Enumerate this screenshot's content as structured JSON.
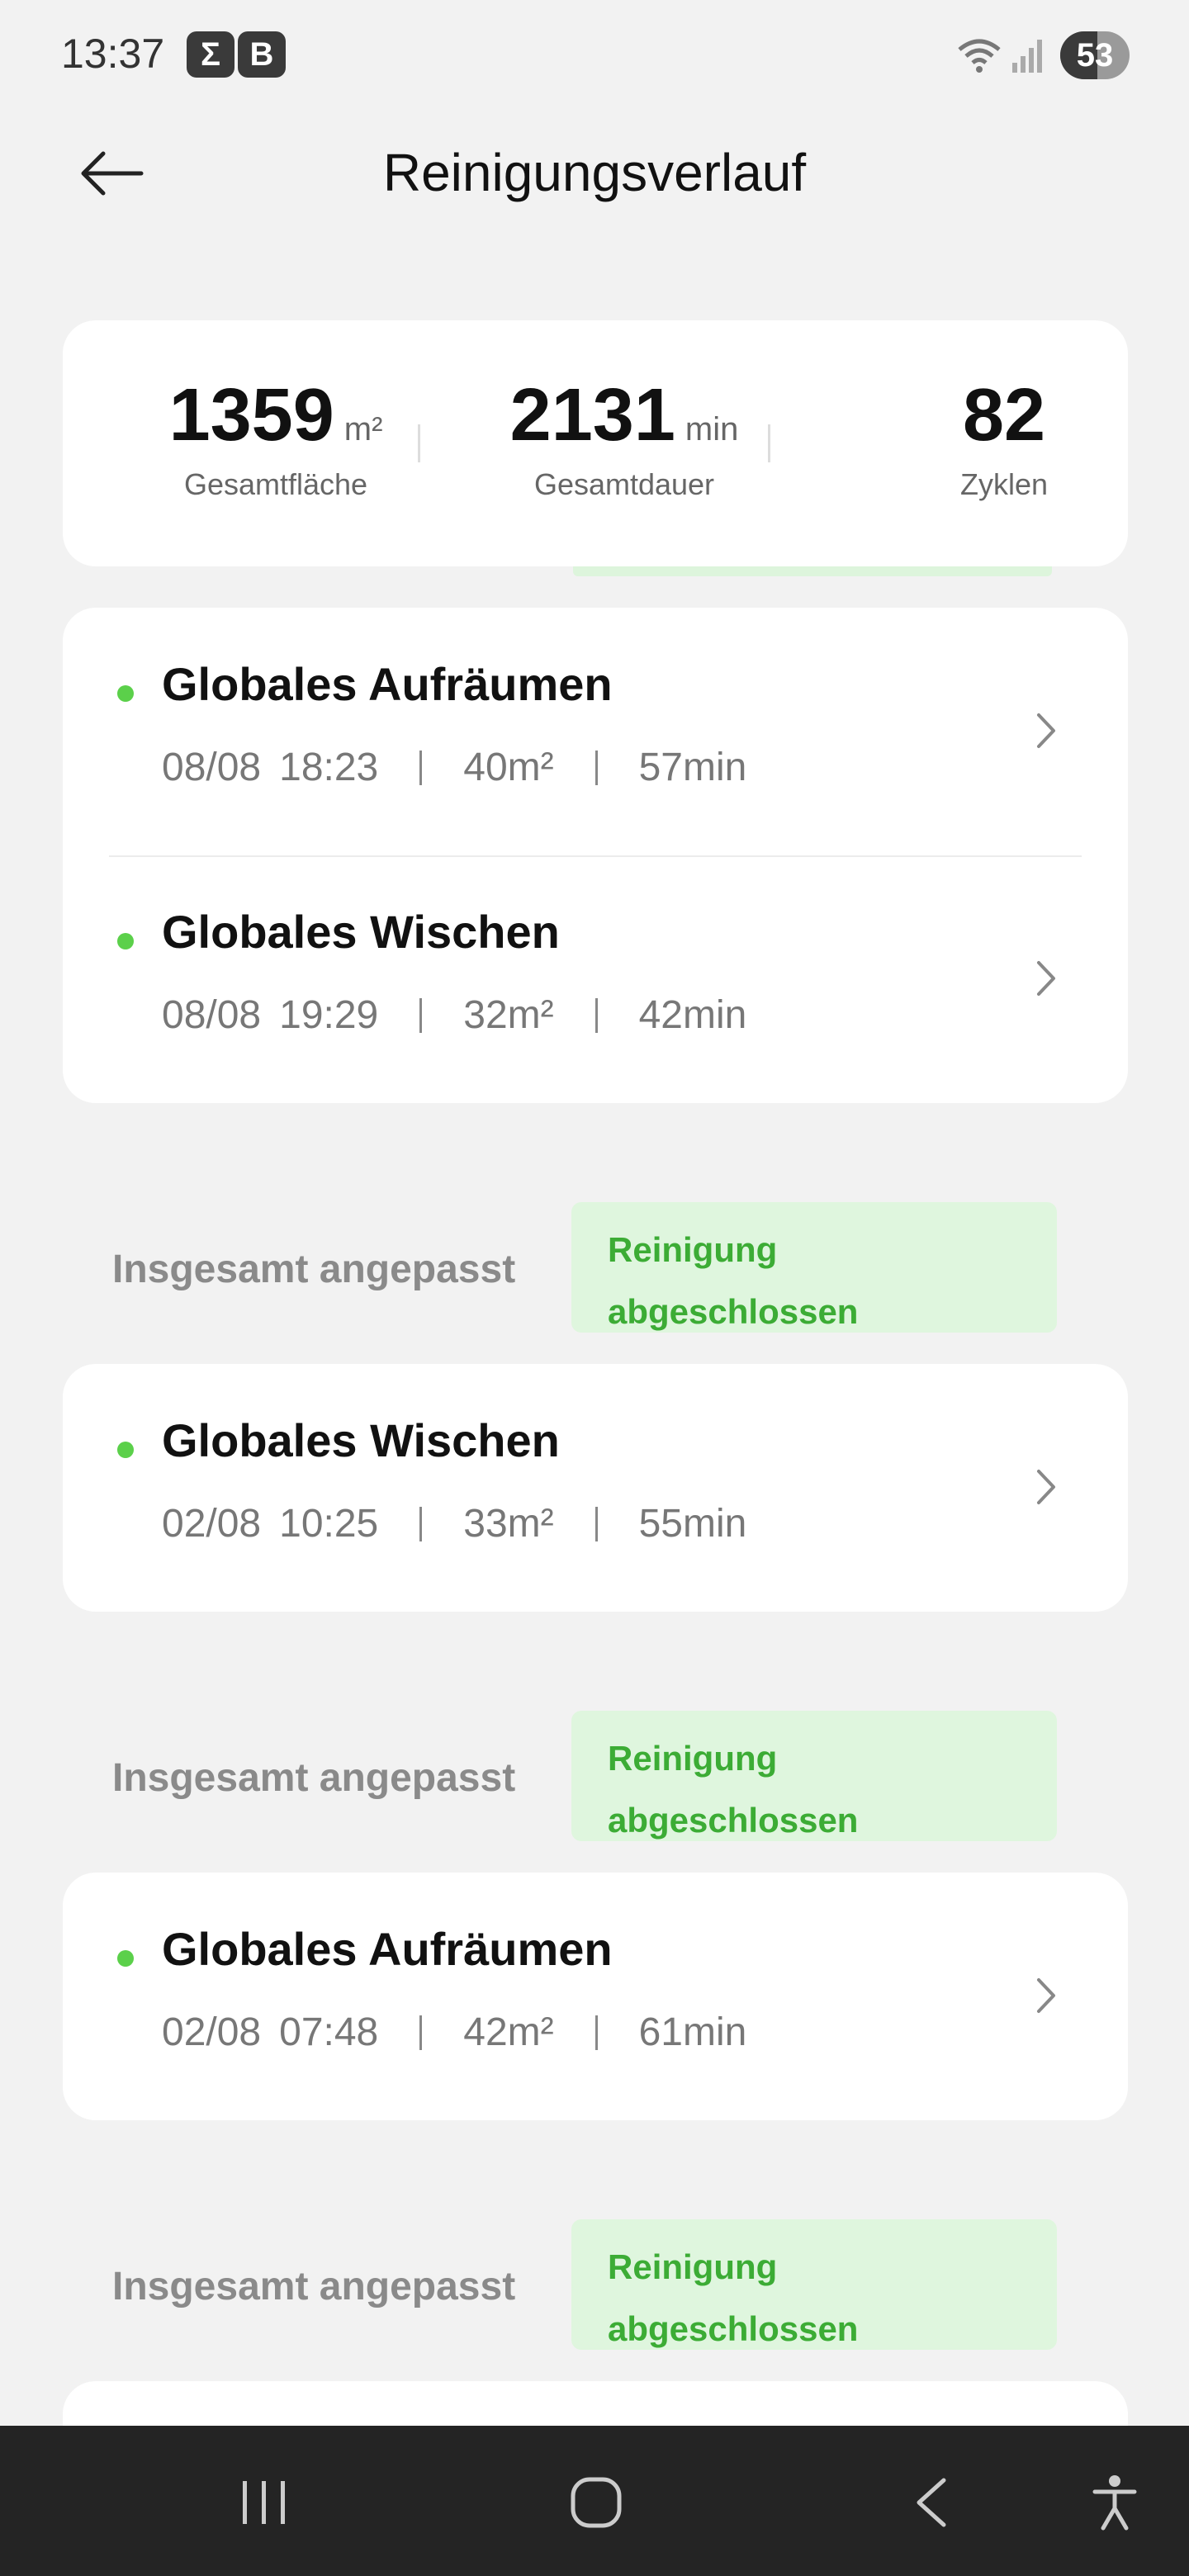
{
  "status_bar": {
    "time": "13:37",
    "notifications": [
      {
        "icon": "sigma-icon",
        "glyph": "Σ"
      },
      {
        "icon": "b-app-icon",
        "glyph": "B"
      }
    ],
    "wifi_icon": "wifi-icon",
    "signal_icon": "signal-icon",
    "battery": {
      "level": 53,
      "text": "53"
    }
  },
  "header": {
    "back_icon": "back-arrow-icon",
    "title": "Reinigungsverlauf"
  },
  "summary": {
    "area": {
      "value": "1359",
      "unit": "m²",
      "label": "Gesamtfläche"
    },
    "duration": {
      "value": "2131",
      "unit": "min",
      "label": "Gesamtdauer"
    },
    "cycles": {
      "value": "82",
      "label": "Zyklen"
    }
  },
  "groups": [
    {
      "records": [
        {
          "title": "Globales Aufräumen",
          "date": "08/08",
          "time": "18:23",
          "area": "40m²",
          "duration": "57min"
        },
        {
          "title": "Globales Wischen",
          "date": "08/08",
          "time": "19:29",
          "area": "32m²",
          "duration": "42min"
        }
      ]
    },
    {
      "label": "Insgesamt angepasst",
      "status": "Reinigung abgeschlossen",
      "records": [
        {
          "title": "Globales Wischen",
          "date": "02/08",
          "time": "10:25",
          "area": "33m²",
          "duration": "55min"
        }
      ]
    },
    {
      "label": "Insgesamt angepasst",
      "status": "Reinigung abgeschlossen",
      "records": [
        {
          "title": "Globales Aufräumen",
          "date": "02/08",
          "time": "07:48",
          "area": "42m²",
          "duration": "61min"
        }
      ]
    },
    {
      "label": "Insgesamt angepasst",
      "status": "Reinigung abgeschlossen",
      "records": []
    }
  ],
  "colors": {
    "accent_green": "#5bd04a",
    "badge_bg": "#dff6de",
    "badge_text": "#3cac35",
    "background": "#f2f2f2"
  },
  "nav_bar": {
    "icons": [
      "recent-apps-icon",
      "home-icon",
      "back-icon",
      "accessibility-icon"
    ]
  }
}
